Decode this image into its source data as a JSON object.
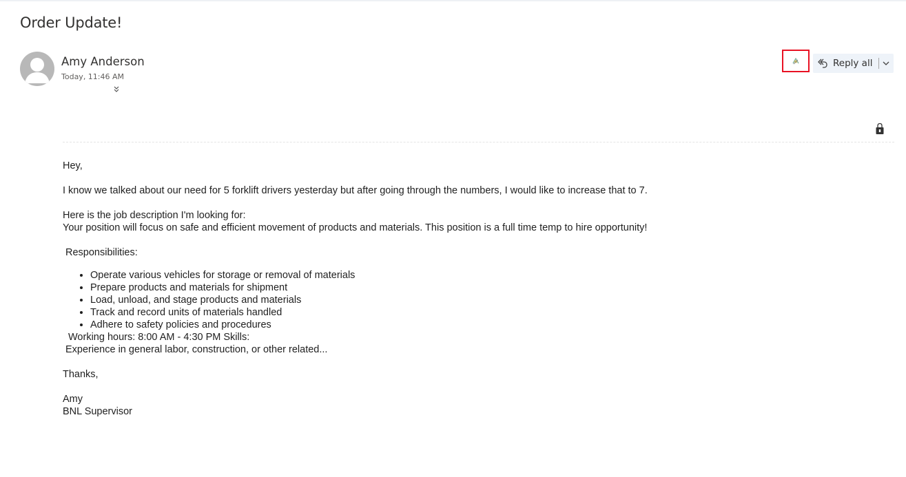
{
  "email": {
    "subject": "Order Update!",
    "sender_name": "Amy Anderson",
    "sent_time": "Today, 11:46 AM"
  },
  "toolbar": {
    "reply_all_label": "Reply all"
  },
  "body": {
    "greeting": "Hey,",
    "paragraph1": "I know we talked about our need for 5 forklift drivers yesterday but after going through the numbers, I would like to increase that to 7.",
    "job_intro": "Here is the job description I'm looking for:",
    "job_summary": "Your position will focus on safe and efficient movement of products and materials. This position is a full time temp to hire opportunity!",
    "responsibilities_heading": "Responsibilities:",
    "responsibilities": [
      "Operate various vehicles for storage or removal of materials",
      "Prepare products and materials for shipment",
      "Load, unload, and stage products and materials",
      "Track and record units of materials handled",
      "Adhere to safety policies and procedures"
    ],
    "working_hours": "Working hours: 8:00 AM - 4:30 PM Skills:",
    "experience": "Experience in general labor, construction, or other related...",
    "closing": "Thanks,",
    "signature_name": "Amy",
    "signature_title": "BNL Supervisor"
  },
  "icons": [
    "avatar-person-icon",
    "double-chevron-down-icon",
    "add-in-icon",
    "reply-all-icon",
    "chevron-down-icon",
    "lock-icon"
  ],
  "colors": {
    "highlight_border": "#e81123",
    "reply_bg": "#eef3f9",
    "avatar_bg": "#b8b8b8"
  }
}
